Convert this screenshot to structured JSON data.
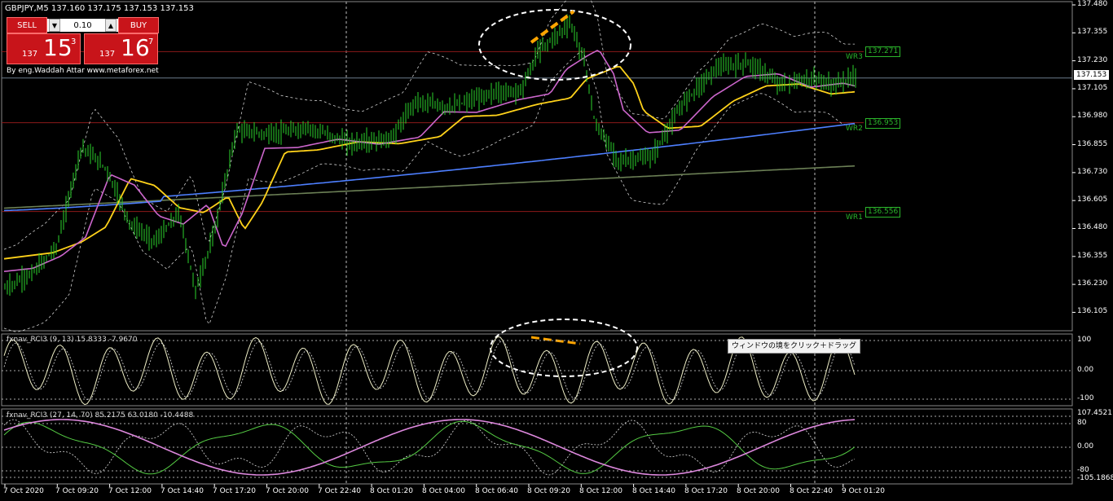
{
  "header": {
    "symbol": "GBPJPY,M5  137.160 137.175 137.153 137.153"
  },
  "trade_panel": {
    "sell_label": "SELL",
    "buy_label": "BUY",
    "lot_value": "0.10",
    "sell_price_small": "137",
    "sell_price_big": "15",
    "sell_price_sup": "3",
    "buy_price_small": "137",
    "buy_price_big": "16",
    "buy_price_sup": "7"
  },
  "author": "By eng.Waddah Attar  www.metaforex.net",
  "price_axis": {
    "labels": [
      "137.480",
      "137.355",
      "137.230",
      "137.105",
      "136.980",
      "136.855",
      "136.730",
      "136.605",
      "136.480",
      "136.355",
      "136.230",
      "136.105"
    ],
    "current": "137.153"
  },
  "pivots": [
    {
      "name": "WR3",
      "value": "137.271"
    },
    {
      "name": "WR2",
      "value": "136.953"
    },
    {
      "name": "WR1",
      "value": "136.556"
    }
  ],
  "indicator1": {
    "label": "fxnav_RCI3 (9, 13) 15.8333 -7.9670",
    "levels": [
      "100",
      "0.00",
      "-100"
    ]
  },
  "indicator2": {
    "label": "fxnav_RCI3 (27, 14, 70) 85.2175 63.0180 -10.4488",
    "levels": [
      "107.4521",
      "80",
      "0.00",
      "-80",
      "-105.1868"
    ]
  },
  "tooltip": "ウィンドウの境をクリック＋ドラッグ",
  "time_axis": [
    "7 Oct 2020",
    "7 Oct 09:20",
    "7 Oct 12:00",
    "7 Oct 14:40",
    "7 Oct 17:20",
    "7 Oct 20:00",
    "7 Oct 22:40",
    "8 Oct 01:20",
    "8 Oct 04:00",
    "8 Oct 06:40",
    "8 Oct 09:20",
    "8 Oct 12:00",
    "8 Oct 14:40",
    "8 Oct 17:20",
    "8 Oct 20:00",
    "8 Oct 22:40",
    "9 Oct 01:20"
  ],
  "colors": {
    "candle": "#2bd32b",
    "ma_yellow": "#ffd21a",
    "ma_blue": "#4d7fff",
    "ma_magenta": "#cc66cc",
    "ma_olive": "#6b7f55",
    "pivot_line": "#8b1a1a",
    "accent_orange": "#ffa500",
    "rci_long": "#dd88dd",
    "rci_mid": "#55cc44"
  }
}
